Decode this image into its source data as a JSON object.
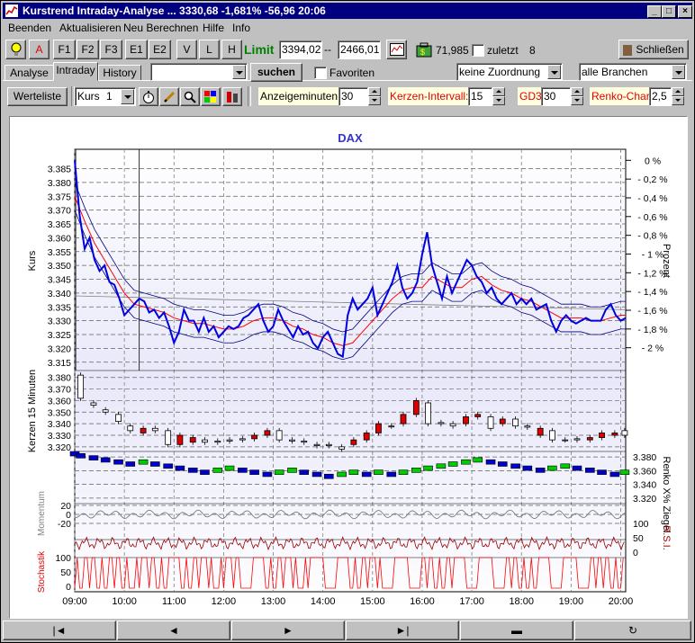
{
  "window": {
    "title": "Kurstrend Intraday-Analyse ...  3330,68  -1,681%  -56,96  20:06",
    "min_label": "_",
    "max_label": "□",
    "close_label": "×"
  },
  "menu": [
    "Beenden",
    "Aktualisieren",
    "Neu Berechnen",
    "Hilfe",
    "Info"
  ],
  "toolbar1": {
    "buttons": [
      "A",
      "F1",
      "F2",
      "F3",
      "E1",
      "E2",
      "V",
      "L",
      "H"
    ],
    "limit_label": "Limit",
    "limit_low": "3394,025",
    "limit_sep": "--",
    "limit_high": "2466,01",
    "price": "71,985",
    "zuletzt_label": "zuletzt",
    "zuletzt_count": "8",
    "close_button": "Schließen"
  },
  "tabs": [
    "Analyse",
    "Intraday",
    "History"
  ],
  "toolbar2": {
    "search_button": "suchen",
    "favoriten_label": "Favoriten",
    "zuordnung": "keine Zuordnung",
    "branchen": "alle Branchen"
  },
  "toolbar3": {
    "werteliste": "Werteliste",
    "kurs_select": "Kurs",
    "kurs_value": "1",
    "anzeige_label": "Anzeigeminuten:",
    "anzeige_value": "30",
    "kerzen_label": "Kerzen-Intervall:",
    "kerzen_value": "15",
    "gd_label": "GD3",
    "gd_value": "30",
    "renko_label": "Renko-Chart",
    "renko_value": "2,5"
  },
  "status_buttons": [
    "|◄",
    "◄",
    "►",
    "►|",
    "▬",
    "↻"
  ],
  "colors": {
    "price_line": "#0000e0",
    "ma_line": "#ff0000",
    "band_line": "#000080",
    "candle_up": "#ffffff",
    "candle_down": "#dd0000",
    "renko_up": "#00cc00",
    "renko_down": "#0000cc",
    "rsi_line": "#990000",
    "stoch_line": "#ff0000",
    "title": "#3333cc"
  },
  "chart_data": {
    "type": "line",
    "title": "DAX",
    "ylabel": "Kurs",
    "ylabel_right": "Prozent",
    "ylim": [
      3312,
      3392
    ],
    "yticks": [
      "3.385",
      "3.380",
      "3.375",
      "3.370",
      "3.365",
      "3.360",
      "3.355",
      "3.350",
      "3.345",
      "3.340",
      "3.335",
      "3.330",
      "3.325",
      "3.320",
      "3.315"
    ],
    "pct_ticks": [
      "0 %",
      "0,2 %",
      "0,4 %",
      "0,6 %",
      "0,8 %",
      "1 %",
      "1,2 %",
      "1,4 %",
      "1,6 %",
      "1,8 %",
      "2 %"
    ],
    "x_ticks": [
      "09:00",
      "10:00",
      "11:00",
      "12:00",
      "13:00",
      "14:00",
      "15:00",
      "16:00",
      "17:00",
      "18:00",
      "19:00",
      "20:00"
    ],
    "x_range": [
      9.0,
      20.1
    ],
    "series": [
      {
        "name": "Kurs",
        "x": [
          9.0,
          9.05,
          9.1,
          9.15,
          9.2,
          9.3,
          9.4,
          9.5,
          9.6,
          9.7,
          9.8,
          9.9,
          10.0,
          10.1,
          10.2,
          10.3,
          10.4,
          10.5,
          10.6,
          10.7,
          10.8,
          10.9,
          11.0,
          11.1,
          11.2,
          11.3,
          11.4,
          11.5,
          11.6,
          11.7,
          11.8,
          11.9,
          12.0,
          12.1,
          12.2,
          12.3,
          12.4,
          12.5,
          12.6,
          12.7,
          12.8,
          12.9,
          13.0,
          13.1,
          13.2,
          13.3,
          13.4,
          13.5,
          13.6,
          13.7,
          13.8,
          13.9,
          14.0,
          14.1,
          14.2,
          14.3,
          14.4,
          14.5,
          14.6,
          14.7,
          14.8,
          14.9,
          15.0,
          15.1,
          15.2,
          15.3,
          15.4,
          15.5,
          15.6,
          15.7,
          15.8,
          15.9,
          16.0,
          16.1,
          16.2,
          16.3,
          16.4,
          16.5,
          16.6,
          16.7,
          16.8,
          16.9,
          17.0,
          17.1,
          17.2,
          17.3,
          17.4,
          17.5,
          17.6,
          17.7,
          17.8,
          17.9,
          18.0,
          18.1,
          18.2,
          18.3,
          18.4,
          18.5,
          18.6,
          18.7,
          18.8,
          18.9,
          19.0,
          19.1,
          19.2,
          19.3,
          19.4,
          19.5,
          19.6,
          19.7,
          19.8,
          19.9,
          20.0,
          20.1
        ],
        "values": [
          3388,
          3378,
          3368,
          3362,
          3356,
          3360,
          3352,
          3348,
          3350,
          3344,
          3343,
          3338,
          3332,
          3334,
          3336,
          3338,
          3337,
          3333,
          3334,
          3331,
          3333,
          3328,
          3322,
          3326,
          3334,
          3330,
          3330,
          3326,
          3331,
          3326,
          3328,
          3324,
          3326,
          3328,
          3327,
          3328,
          3331,
          3332,
          3334,
          3336,
          3330,
          3326,
          3328,
          3334,
          3330,
          3327,
          3324,
          3328,
          3325,
          3326,
          3322,
          3320,
          3324,
          3326,
          3322,
          3318,
          3317,
          3332,
          3338,
          3334,
          3336,
          3338,
          3342,
          3332,
          3336,
          3340,
          3344,
          3350,
          3342,
          3338,
          3340,
          3344,
          3354,
          3362,
          3350,
          3344,
          3338,
          3346,
          3340,
          3344,
          3348,
          3352,
          3350,
          3346,
          3344,
          3340,
          3342,
          3338,
          3336,
          3338,
          3340,
          3336,
          3338,
          3336,
          3338,
          3334,
          3335,
          3336,
          3330,
          3326,
          3330,
          3332,
          3330,
          3329,
          3330,
          3331,
          3330,
          3330,
          3330,
          3334,
          3336,
          3332,
          3330,
          3331
        ]
      },
      {
        "name": "GD",
        "x": [
          9.0,
          9.2,
          9.4,
          9.6,
          9.8,
          10.0,
          10.2,
          10.4,
          10.6,
          10.8,
          11.0,
          11.2,
          11.4,
          11.6,
          11.8,
          12.0,
          12.2,
          12.4,
          12.6,
          12.8,
          13.0,
          13.2,
          13.4,
          13.6,
          13.8,
          14.0,
          14.2,
          14.4,
          14.6,
          14.8,
          15.0,
          15.2,
          15.4,
          15.6,
          15.8,
          16.0,
          16.2,
          16.4,
          16.6,
          16.8,
          17.0,
          17.2,
          17.4,
          17.6,
          17.8,
          18.0,
          18.2,
          18.4,
          18.6,
          18.8,
          19.0,
          19.2,
          19.4,
          19.6,
          19.8,
          20.0,
          20.1
        ],
        "values": [
          3375,
          3366,
          3358,
          3352,
          3346,
          3340,
          3336,
          3335,
          3334,
          3333,
          3331,
          3330,
          3329,
          3329,
          3328,
          3327,
          3327,
          3328,
          3330,
          3331,
          3331,
          3330,
          3328,
          3327,
          3325,
          3324,
          3322,
          3321,
          3322,
          3326,
          3330,
          3334,
          3338,
          3341,
          3342,
          3342,
          3346,
          3344,
          3342,
          3342,
          3345,
          3346,
          3343,
          3341,
          3340,
          3338,
          3337,
          3335,
          3333,
          3331,
          3331,
          3331,
          3330,
          3330,
          3331,
          3332,
          3332
        ]
      }
    ],
    "panels": {
      "kerzen": {
        "ylabel": "Kerzen 15 Minuten",
        "yticks": [
          "3.380",
          "3.370",
          "3.360",
          "3.350",
          "3.340",
          "3.330",
          "3.320"
        ],
        "ylim": [
          3316,
          3386
        ],
        "candles": [
          {
            "t": 9.12,
            "o": 3362,
            "c": 3382,
            "up": true
          },
          {
            "t": 9.38,
            "o": 3358,
            "c": 3356,
            "up": true
          },
          {
            "t": 9.62,
            "o": 3352,
            "c": 3350,
            "up": true
          },
          {
            "t": 9.88,
            "o": 3348,
            "c": 3342,
            "up": true
          },
          {
            "t": 10.12,
            "o": 3338,
            "c": 3334,
            "up": true
          },
          {
            "t": 10.38,
            "o": 3336,
            "c": 3332,
            "up": false
          },
          {
            "t": 10.62,
            "o": 3334,
            "c": 3336,
            "up": true
          },
          {
            "t": 10.88,
            "o": 3334,
            "c": 3322,
            "up": true
          },
          {
            "t": 11.12,
            "o": 3330,
            "c": 3322,
            "up": false
          },
          {
            "t": 11.38,
            "o": 3328,
            "c": 3324,
            "up": false
          },
          {
            "t": 11.62,
            "o": 3326,
            "c": 3324,
            "up": true
          },
          {
            "t": 11.88,
            "o": 3324,
            "c": 3325,
            "up": true
          },
          {
            "t": 12.12,
            "o": 3325,
            "c": 3326,
            "up": true
          },
          {
            "t": 12.38,
            "o": 3326,
            "c": 3327,
            "up": true
          },
          {
            "t": 12.62,
            "o": 3327,
            "c": 3330,
            "up": false
          },
          {
            "t": 12.88,
            "o": 3330,
            "c": 3334,
            "up": false
          },
          {
            "t": 13.12,
            "o": 3334,
            "c": 3326,
            "up": true
          },
          {
            "t": 13.38,
            "o": 3325,
            "c": 3326,
            "up": true
          },
          {
            "t": 13.62,
            "o": 3325,
            "c": 3324,
            "up": true
          },
          {
            "t": 13.88,
            "o": 3322,
            "c": 3321,
            "up": true
          },
          {
            "t": 14.12,
            "o": 3321,
            "c": 3322,
            "up": true
          },
          {
            "t": 14.38,
            "o": 3320,
            "c": 3318,
            "up": true
          },
          {
            "t": 14.62,
            "o": 3322,
            "c": 3326,
            "up": false
          },
          {
            "t": 14.88,
            "o": 3326,
            "c": 3332,
            "up": false
          },
          {
            "t": 15.12,
            "o": 3332,
            "c": 3340,
            "up": false
          },
          {
            "t": 15.38,
            "o": 3338,
            "c": 3338,
            "up": true
          },
          {
            "t": 15.62,
            "o": 3340,
            "c": 3348,
            "up": false
          },
          {
            "t": 15.88,
            "o": 3348,
            "c": 3360,
            "up": false
          },
          {
            "t": 16.12,
            "o": 3358,
            "c": 3340,
            "up": true
          },
          {
            "t": 16.38,
            "o": 3340,
            "c": 3341,
            "up": true
          },
          {
            "t": 16.62,
            "o": 3338,
            "c": 3340,
            "up": true
          },
          {
            "t": 16.88,
            "o": 3340,
            "c": 3346,
            "up": false
          },
          {
            "t": 17.12,
            "o": 3346,
            "c": 3348,
            "up": false
          },
          {
            "t": 17.38,
            "o": 3346,
            "c": 3336,
            "up": true
          },
          {
            "t": 17.62,
            "o": 3340,
            "c": 3344,
            "up": false
          },
          {
            "t": 17.88,
            "o": 3344,
            "c": 3338,
            "up": true
          },
          {
            "t": 18.12,
            "o": 3338,
            "c": 3337,
            "up": true
          },
          {
            "t": 18.38,
            "o": 3336,
            "c": 3330,
            "up": false
          },
          {
            "t": 18.62,
            "o": 3334,
            "c": 3326,
            "up": true
          },
          {
            "t": 18.88,
            "o": 3326,
            "c": 3326,
            "up": true
          },
          {
            "t": 19.12,
            "o": 3326,
            "c": 3327,
            "up": true
          },
          {
            "t": 19.38,
            "o": 3326,
            "c": 3328,
            "up": false
          },
          {
            "t": 19.62,
            "o": 3328,
            "c": 3332,
            "up": false
          },
          {
            "t": 19.88,
            "o": 3332,
            "c": 3330,
            "up": false
          },
          {
            "t": 20.08,
            "o": 3330,
            "c": 3334,
            "up": true
          }
        ]
      },
      "renko": {
        "ylabel": "Renko X% Ziegel",
        "yticks": [
          "3.380",
          "3.360",
          "3.340",
          "3.320"
        ],
        "ylim": [
          3312,
          3388
        ],
        "bricks": [
          {
            "t": 9.0,
            "v": 3384,
            "up": false
          },
          {
            "t": 9.12,
            "v": 3381,
            "up": false
          },
          {
            "t": 9.38,
            "v": 3378,
            "up": false
          },
          {
            "t": 9.62,
            "v": 3375,
            "up": false
          },
          {
            "t": 9.88,
            "v": 3372,
            "up": false
          },
          {
            "t": 10.12,
            "v": 3369,
            "up": false
          },
          {
            "t": 10.38,
            "v": 3372,
            "up": true
          },
          {
            "t": 10.62,
            "v": 3369,
            "up": false
          },
          {
            "t": 10.88,
            "v": 3366,
            "up": false
          },
          {
            "t": 11.12,
            "v": 3363,
            "up": false
          },
          {
            "t": 11.38,
            "v": 3360,
            "up": false
          },
          {
            "t": 11.62,
            "v": 3357,
            "up": false
          },
          {
            "t": 11.88,
            "v": 3360,
            "up": true
          },
          {
            "t": 12.12,
            "v": 3363,
            "up": true
          },
          {
            "t": 12.38,
            "v": 3360,
            "up": false
          },
          {
            "t": 12.62,
            "v": 3357,
            "up": false
          },
          {
            "t": 12.88,
            "v": 3354,
            "up": false
          },
          {
            "t": 13.12,
            "v": 3357,
            "up": true
          },
          {
            "t": 13.38,
            "v": 3360,
            "up": true
          },
          {
            "t": 13.62,
            "v": 3357,
            "up": false
          },
          {
            "t": 13.88,
            "v": 3354,
            "up": false
          },
          {
            "t": 14.12,
            "v": 3351,
            "up": false
          },
          {
            "t": 14.38,
            "v": 3354,
            "up": true
          },
          {
            "t": 14.62,
            "v": 3357,
            "up": true
          },
          {
            "t": 14.88,
            "v": 3354,
            "up": false
          },
          {
            "t": 15.12,
            "v": 3357,
            "up": true
          },
          {
            "t": 15.38,
            "v": 3354,
            "up": false
          },
          {
            "t": 15.62,
            "v": 3357,
            "up": true
          },
          {
            "t": 15.88,
            "v": 3360,
            "up": true
          },
          {
            "t": 16.12,
            "v": 3363,
            "up": true
          },
          {
            "t": 16.38,
            "v": 3366,
            "up": true
          },
          {
            "t": 16.62,
            "v": 3369,
            "up": true
          },
          {
            "t": 16.88,
            "v": 3372,
            "up": true
          },
          {
            "t": 17.12,
            "v": 3375,
            "up": true
          },
          {
            "t": 17.38,
            "v": 3372,
            "up": false
          },
          {
            "t": 17.62,
            "v": 3369,
            "up": false
          },
          {
            "t": 17.88,
            "v": 3366,
            "up": false
          },
          {
            "t": 18.12,
            "v": 3363,
            "up": false
          },
          {
            "t": 18.38,
            "v": 3360,
            "up": false
          },
          {
            "t": 18.62,
            "v": 3363,
            "up": true
          },
          {
            "t": 18.88,
            "v": 3366,
            "up": true
          },
          {
            "t": 19.12,
            "v": 3363,
            "up": false
          },
          {
            "t": 19.38,
            "v": 3360,
            "up": false
          },
          {
            "t": 19.62,
            "v": 3357,
            "up": false
          },
          {
            "t": 19.88,
            "v": 3354,
            "up": false
          },
          {
            "t": 20.08,
            "v": 3357,
            "up": true
          }
        ]
      },
      "momentum": {
        "ylabel": "Momentum",
        "yticks": [
          "20",
          "0",
          "-20"
        ]
      },
      "rsi": {
        "ylabel": "R.S.I.",
        "yticks": [
          "100",
          "50",
          "0"
        ]
      },
      "stochastik": {
        "ylabel": "Stochastik",
        "yticks": [
          "100",
          "50",
          "0"
        ]
      }
    }
  }
}
